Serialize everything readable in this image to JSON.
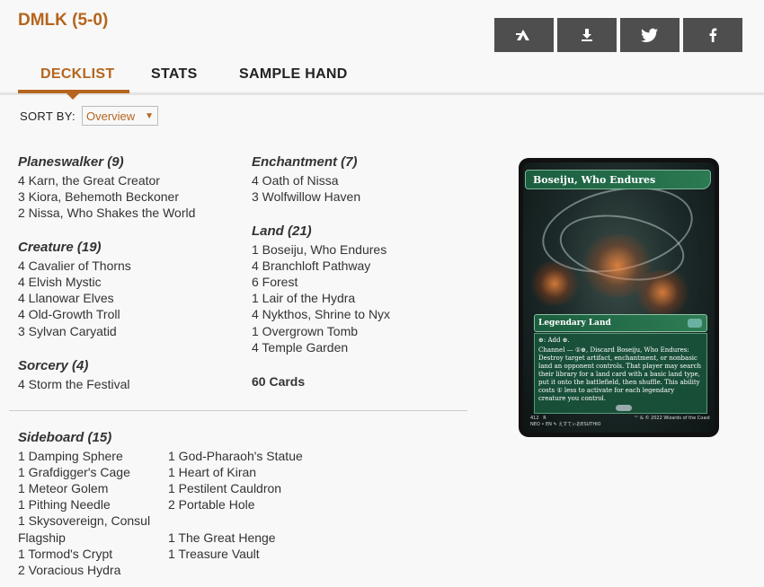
{
  "deck": {
    "title": "DMLK (5-0)"
  },
  "share": {
    "icons": [
      "arena-icon",
      "download-icon",
      "twitter-icon",
      "facebook-icon"
    ]
  },
  "tabs": {
    "items": [
      "DECKLIST",
      "STATS",
      "SAMPLE HAND"
    ],
    "active": "DECKLIST"
  },
  "sort": {
    "label": "SORT BY:",
    "selected": "Overview"
  },
  "sections": {
    "planeswalker": {
      "title": "Planeswalker (9)",
      "cards": [
        "4 Karn, the Great Creator",
        "3 Kiora, Behemoth Beckoner",
        "2 Nissa, Who Shakes the World"
      ]
    },
    "creature": {
      "title": "Creature (19)",
      "cards": [
        "4 Cavalier of Thorns",
        "4 Elvish Mystic",
        "4 Llanowar Elves",
        "4 Old-Growth Troll",
        "3 Sylvan Caryatid"
      ]
    },
    "sorcery": {
      "title": "Sorcery (4)",
      "cards": [
        "4 Storm the Festival"
      ]
    },
    "enchantment": {
      "title": "Enchantment (7)",
      "cards": [
        "4 Oath of Nissa",
        "3 Wolfwillow Haven"
      ]
    },
    "land": {
      "title": "Land (21)",
      "cards": [
        "1 Boseiju, Who Endures",
        "4 Branchloft Pathway",
        "6 Forest",
        "1 Lair of the Hydra",
        "4 Nykthos, Shrine to Nyx",
        "1 Overgrown Tomb",
        "4 Temple Garden"
      ]
    },
    "total": "60 Cards",
    "sideboard": {
      "title": "Sideboard (15)",
      "col1": [
        "1 Damping Sphere",
        "1 Grafdigger's Cage",
        "1 Meteor Golem",
        "1 Pithing Needle",
        "1 Skysovereign, Consul",
        "Flagship",
        "1 Tormod's Crypt",
        "2 Voracious Hydra"
      ],
      "col2": [
        "1 God-Pharaoh's Statue",
        "1 Heart of Kiran",
        "1 Pestilent Cauldron",
        "2 Portable Hole",
        "",
        "1 The Great Henge",
        "1 Treasure Vault"
      ]
    }
  },
  "card_preview": {
    "name": "Boseiju, Who Endures",
    "type": "Legendary Land",
    "ability1": "⊕: Add ⊕.",
    "ability2": "Channel — ①⊕, Discard Boseiju, Who Endures: Destroy target artifact, enchantment, or nonbasic land an opponent controls. That player may search their library for a land card with a basic land type, put it onto the battlefield, then shuffle. This ability costs ① less to activate for each legendary creature you control.",
    "footer_left": "412   R\nNEO • EN ✎ えすてぃおESUTHIO",
    "footer_right": "™ & © 2022 Wizards of the Coast"
  }
}
